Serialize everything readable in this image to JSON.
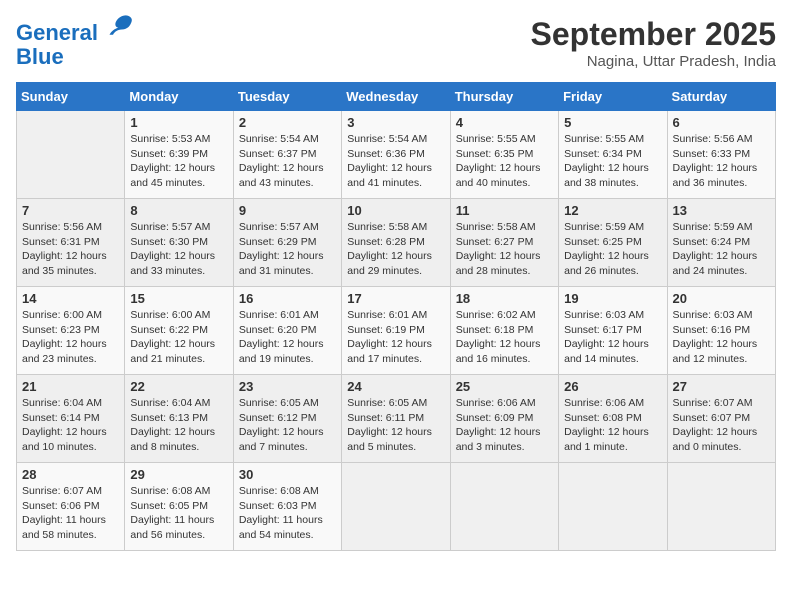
{
  "header": {
    "logo_line1": "General",
    "logo_line2": "Blue",
    "month": "September 2025",
    "location": "Nagina, Uttar Pradesh, India"
  },
  "weekdays": [
    "Sunday",
    "Monday",
    "Tuesday",
    "Wednesday",
    "Thursday",
    "Friday",
    "Saturday"
  ],
  "weeks": [
    [
      {
        "day": "",
        "info": ""
      },
      {
        "day": "1",
        "info": "Sunrise: 5:53 AM\nSunset: 6:39 PM\nDaylight: 12 hours\nand 45 minutes."
      },
      {
        "day": "2",
        "info": "Sunrise: 5:54 AM\nSunset: 6:37 PM\nDaylight: 12 hours\nand 43 minutes."
      },
      {
        "day": "3",
        "info": "Sunrise: 5:54 AM\nSunset: 6:36 PM\nDaylight: 12 hours\nand 41 minutes."
      },
      {
        "day": "4",
        "info": "Sunrise: 5:55 AM\nSunset: 6:35 PM\nDaylight: 12 hours\nand 40 minutes."
      },
      {
        "day": "5",
        "info": "Sunrise: 5:55 AM\nSunset: 6:34 PM\nDaylight: 12 hours\nand 38 minutes."
      },
      {
        "day": "6",
        "info": "Sunrise: 5:56 AM\nSunset: 6:33 PM\nDaylight: 12 hours\nand 36 minutes."
      }
    ],
    [
      {
        "day": "7",
        "info": "Sunrise: 5:56 AM\nSunset: 6:31 PM\nDaylight: 12 hours\nand 35 minutes."
      },
      {
        "day": "8",
        "info": "Sunrise: 5:57 AM\nSunset: 6:30 PM\nDaylight: 12 hours\nand 33 minutes."
      },
      {
        "day": "9",
        "info": "Sunrise: 5:57 AM\nSunset: 6:29 PM\nDaylight: 12 hours\nand 31 minutes."
      },
      {
        "day": "10",
        "info": "Sunrise: 5:58 AM\nSunset: 6:28 PM\nDaylight: 12 hours\nand 29 minutes."
      },
      {
        "day": "11",
        "info": "Sunrise: 5:58 AM\nSunset: 6:27 PM\nDaylight: 12 hours\nand 28 minutes."
      },
      {
        "day": "12",
        "info": "Sunrise: 5:59 AM\nSunset: 6:25 PM\nDaylight: 12 hours\nand 26 minutes."
      },
      {
        "day": "13",
        "info": "Sunrise: 5:59 AM\nSunset: 6:24 PM\nDaylight: 12 hours\nand 24 minutes."
      }
    ],
    [
      {
        "day": "14",
        "info": "Sunrise: 6:00 AM\nSunset: 6:23 PM\nDaylight: 12 hours\nand 23 minutes."
      },
      {
        "day": "15",
        "info": "Sunrise: 6:00 AM\nSunset: 6:22 PM\nDaylight: 12 hours\nand 21 minutes."
      },
      {
        "day": "16",
        "info": "Sunrise: 6:01 AM\nSunset: 6:20 PM\nDaylight: 12 hours\nand 19 minutes."
      },
      {
        "day": "17",
        "info": "Sunrise: 6:01 AM\nSunset: 6:19 PM\nDaylight: 12 hours\nand 17 minutes."
      },
      {
        "day": "18",
        "info": "Sunrise: 6:02 AM\nSunset: 6:18 PM\nDaylight: 12 hours\nand 16 minutes."
      },
      {
        "day": "19",
        "info": "Sunrise: 6:03 AM\nSunset: 6:17 PM\nDaylight: 12 hours\nand 14 minutes."
      },
      {
        "day": "20",
        "info": "Sunrise: 6:03 AM\nSunset: 6:16 PM\nDaylight: 12 hours\nand 12 minutes."
      }
    ],
    [
      {
        "day": "21",
        "info": "Sunrise: 6:04 AM\nSunset: 6:14 PM\nDaylight: 12 hours\nand 10 minutes."
      },
      {
        "day": "22",
        "info": "Sunrise: 6:04 AM\nSunset: 6:13 PM\nDaylight: 12 hours\nand 8 minutes."
      },
      {
        "day": "23",
        "info": "Sunrise: 6:05 AM\nSunset: 6:12 PM\nDaylight: 12 hours\nand 7 minutes."
      },
      {
        "day": "24",
        "info": "Sunrise: 6:05 AM\nSunset: 6:11 PM\nDaylight: 12 hours\nand 5 minutes."
      },
      {
        "day": "25",
        "info": "Sunrise: 6:06 AM\nSunset: 6:09 PM\nDaylight: 12 hours\nand 3 minutes."
      },
      {
        "day": "26",
        "info": "Sunrise: 6:06 AM\nSunset: 6:08 PM\nDaylight: 12 hours\nand 1 minute."
      },
      {
        "day": "27",
        "info": "Sunrise: 6:07 AM\nSunset: 6:07 PM\nDaylight: 12 hours\nand 0 minutes."
      }
    ],
    [
      {
        "day": "28",
        "info": "Sunrise: 6:07 AM\nSunset: 6:06 PM\nDaylight: 11 hours\nand 58 minutes."
      },
      {
        "day": "29",
        "info": "Sunrise: 6:08 AM\nSunset: 6:05 PM\nDaylight: 11 hours\nand 56 minutes."
      },
      {
        "day": "30",
        "info": "Sunrise: 6:08 AM\nSunset: 6:03 PM\nDaylight: 11 hours\nand 54 minutes."
      },
      {
        "day": "",
        "info": ""
      },
      {
        "day": "",
        "info": ""
      },
      {
        "day": "",
        "info": ""
      },
      {
        "day": "",
        "info": ""
      }
    ]
  ]
}
